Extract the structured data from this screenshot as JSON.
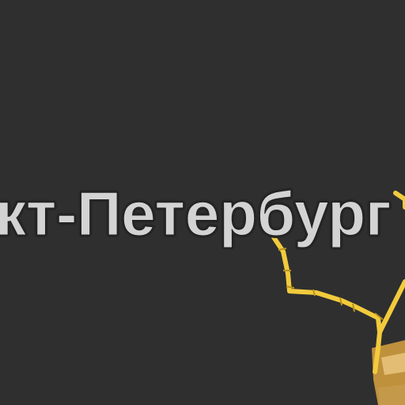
{
  "map": {
    "city_label": "кт-Петербург",
    "colors": {
      "background": "#2f2f2f",
      "ring_road": "#f2cb3c",
      "ring_road_dark": "#b89320",
      "district_fill": "#d9a23e",
      "district_fill_light": "#e8c27a",
      "label": "#d3d3d3",
      "label_halo": "#262626"
    }
  }
}
